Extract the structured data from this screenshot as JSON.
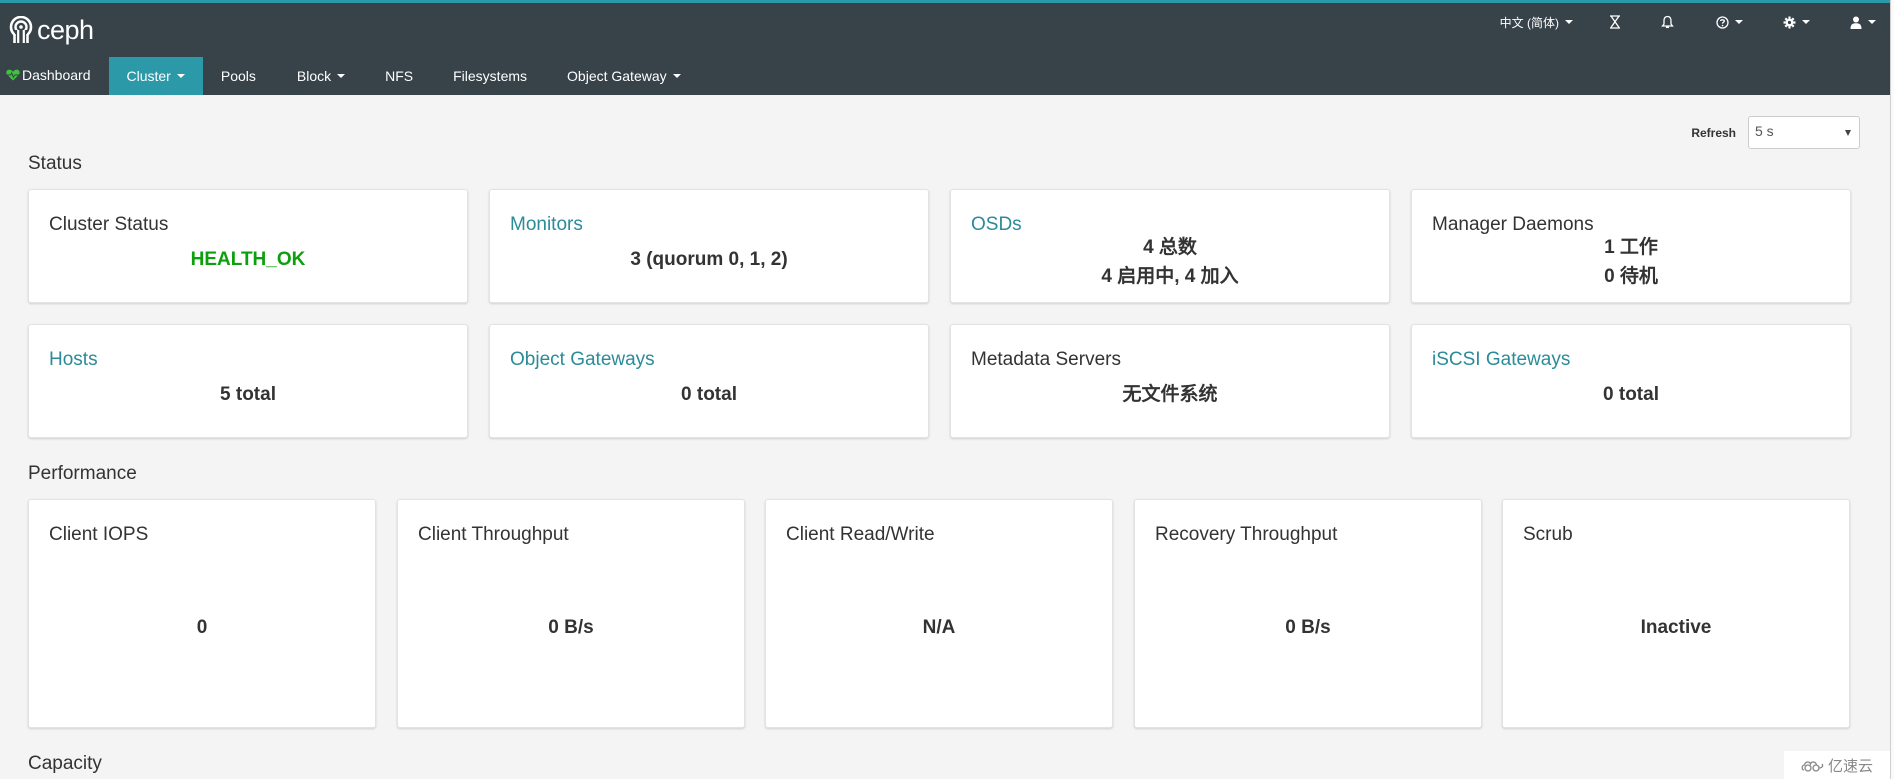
{
  "brand": {
    "name": "ceph"
  },
  "nav": {
    "tabs": [
      {
        "label": "Dashboard",
        "icon": "heartbeat-icon",
        "dropdown": false,
        "active": true
      },
      {
        "label": "Cluster",
        "dropdown": true,
        "highlighted": true
      },
      {
        "label": "Pools",
        "dropdown": false
      },
      {
        "label": "Block",
        "dropdown": true
      },
      {
        "label": "NFS",
        "dropdown": false
      },
      {
        "label": "Filesystems",
        "dropdown": false
      },
      {
        "label": "Object Gateway",
        "dropdown": true
      }
    ],
    "right": {
      "language": "中文 (简体)",
      "task_icon": "hourglass-icon",
      "notification_icon": "bell-icon",
      "help_icon": "question-circle-icon",
      "settings_icon": "gear-icon",
      "user_icon": "user-icon"
    }
  },
  "refresh": {
    "label": "Refresh",
    "value": "5 s"
  },
  "sections": {
    "status": "Status",
    "performance": "Performance",
    "capacity": "Capacity"
  },
  "status_cards": [
    {
      "title": "Cluster Status",
      "link": false,
      "values": [
        "HEALTH_OK"
      ],
      "status_color": "#0ca10c"
    },
    {
      "title": "Monitors",
      "link": true,
      "values": [
        "3 (quorum 0, 1, 2)"
      ]
    },
    {
      "title": "OSDs",
      "link": true,
      "values": [
        "4 总数",
        "4 启用中, 4 加入"
      ]
    },
    {
      "title": "Manager Daemons",
      "link": false,
      "values": [
        "1 工作",
        "0 待机"
      ]
    },
    {
      "title": "Hosts",
      "link": true,
      "values": [
        "5 total"
      ]
    },
    {
      "title": "Object Gateways",
      "link": true,
      "values": [
        "0 total"
      ]
    },
    {
      "title": "Metadata Servers",
      "link": false,
      "values": [
        "无文件系统"
      ]
    },
    {
      "title": "iSCSI Gateways",
      "link": true,
      "values": [
        "0 total"
      ]
    }
  ],
  "performance_cards": [
    {
      "title": "Client IOPS",
      "value": "0"
    },
    {
      "title": "Client Throughput",
      "value": "0 B/s"
    },
    {
      "title": "Client Read/Write",
      "value": "N/A"
    },
    {
      "title": "Recovery Throughput",
      "value": "0 B/s"
    },
    {
      "title": "Scrub",
      "value": "Inactive"
    }
  ],
  "watermark": {
    "text": "亿速云"
  },
  "colors": {
    "navbar_bg": "#374249",
    "accent": "#2b99a8",
    "link": "#2b8b99",
    "health_ok": "#0ca10c"
  }
}
